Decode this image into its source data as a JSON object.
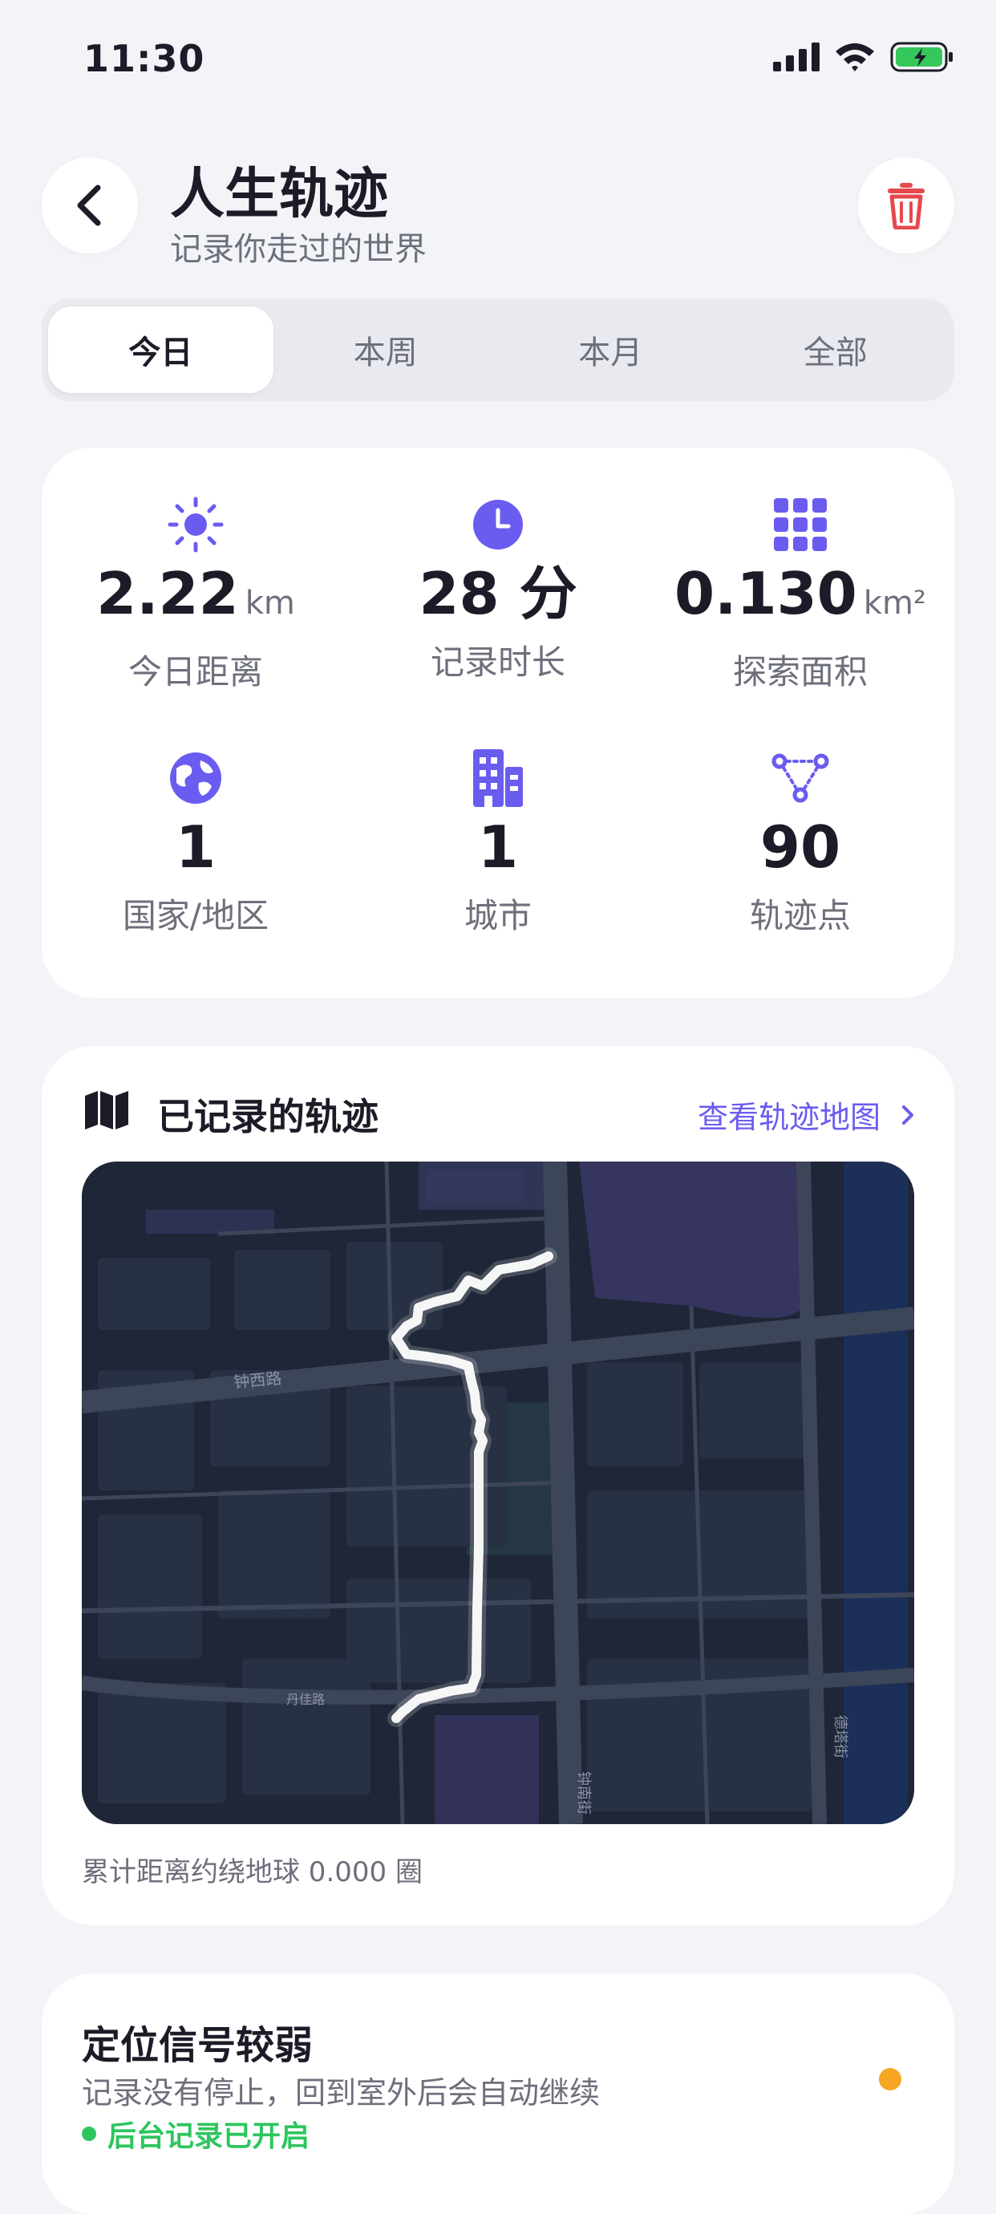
{
  "status_bar": {
    "time": "11:30"
  },
  "header": {
    "title": "人生轨迹",
    "subtitle": "记录你走过的世界"
  },
  "tabs": [
    {
      "label": "今日",
      "active": true
    },
    {
      "label": "本周",
      "active": false
    },
    {
      "label": "本月",
      "active": false
    },
    {
      "label": "全部",
      "active": false
    }
  ],
  "stats": [
    {
      "icon": "sun-icon",
      "value": "2.22",
      "unit": "km",
      "label": "今日距离"
    },
    {
      "icon": "clock-icon",
      "value": "28 分",
      "unit": "",
      "label": "记录时长"
    },
    {
      "icon": "grid-icon",
      "value": "0.130",
      "unit": "km²",
      "label": "探索面积"
    },
    {
      "icon": "globe-icon",
      "value": "1",
      "unit": "",
      "label": "国家/地区"
    },
    {
      "icon": "building-icon",
      "value": "1",
      "unit": "",
      "label": "城市"
    },
    {
      "icon": "track-points-icon",
      "value": "90",
      "unit": "",
      "label": "轨迹点"
    }
  ],
  "tracks": {
    "title": "已记录的轨迹",
    "view_link": "查看轨迹地图",
    "map_labels": {
      "road1": "钟西路",
      "road2": "丹佳路",
      "road3": "钟南街",
      "road4": "德塔街"
    },
    "earth_note": "累计距离约绕地球 0.000 圈"
  },
  "signal": {
    "title": "定位信号较弱",
    "description": "记录没有停止，回到室外后会自动继续",
    "background_status": "后台记录已开启"
  },
  "colors": {
    "accent": "#6b5cf0",
    "danger": "#e5484d",
    "success": "#2ec55e",
    "warning": "#f5a623",
    "map_bg": "#1e2637"
  }
}
